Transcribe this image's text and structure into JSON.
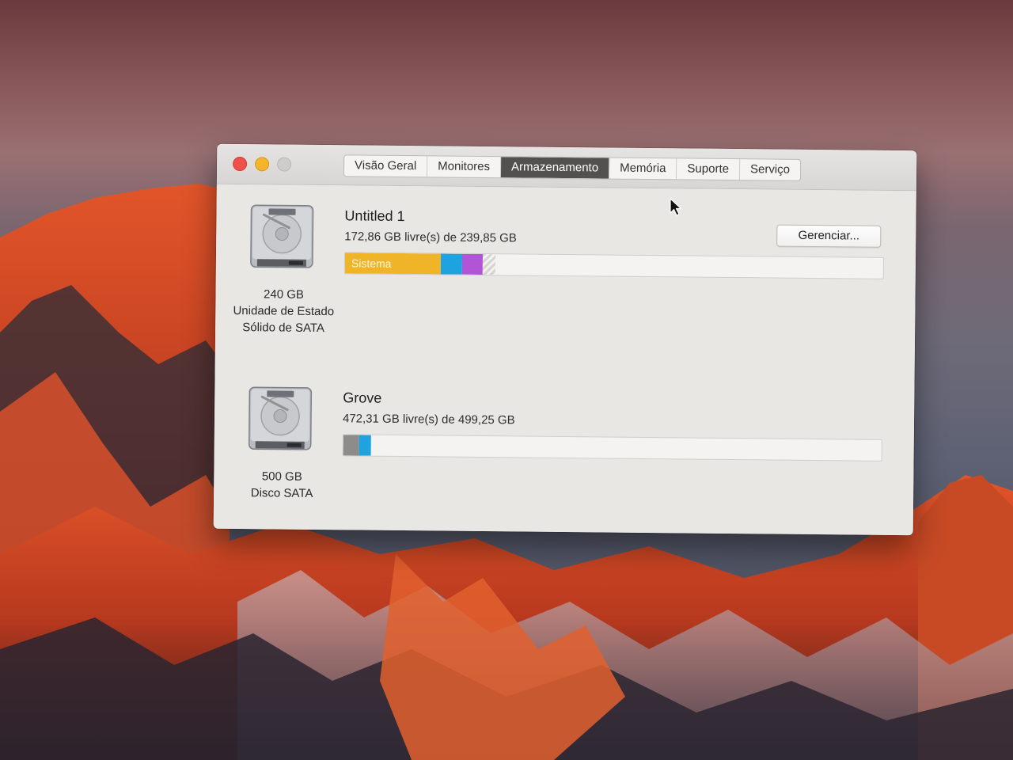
{
  "window": {
    "tabs": [
      {
        "label": "Visão Geral",
        "active": false
      },
      {
        "label": "Monitores",
        "active": false
      },
      {
        "label": "Armazenamento",
        "active": true
      },
      {
        "label": "Memória",
        "active": false
      },
      {
        "label": "Suporte",
        "active": false
      },
      {
        "label": "Serviço",
        "active": false
      }
    ]
  },
  "drives": [
    {
      "icon": "hard-drive-icon",
      "capacity_label": "240 GB",
      "type_label": "Unidade de Estado Sólido de SATA",
      "name": "Untitled 1",
      "free_text": "172,86 GB livre(s) de 239,85 GB",
      "manage_label": "Gerenciar...",
      "usage_segments": [
        {
          "label": "Sistema",
          "fraction": 0.178,
          "color": "#f0b429"
        },
        {
          "label": "",
          "fraction": 0.04,
          "color": "#1ea3e0"
        },
        {
          "label": "",
          "fraction": 0.038,
          "color": "#b254d6"
        },
        {
          "label": "",
          "fraction": 0.024,
          "color": "striped"
        }
      ]
    },
    {
      "icon": "hard-drive-icon",
      "capacity_label": "500 GB",
      "type_label": "Disco SATA",
      "name": "Grove",
      "free_text": "472,31 GB livre(s) de 499,25 GB",
      "usage_segments": [
        {
          "label": "",
          "fraction": 0.03,
          "color": "#8e8c8a"
        },
        {
          "label": "",
          "fraction": 0.022,
          "color": "#1ea3e0"
        }
      ]
    }
  ],
  "colors": {
    "active_tab": "#535150",
    "close_button": "#f0504a",
    "minimize_button": "#f4b42c",
    "maximize_button": "#cfcdcb"
  }
}
